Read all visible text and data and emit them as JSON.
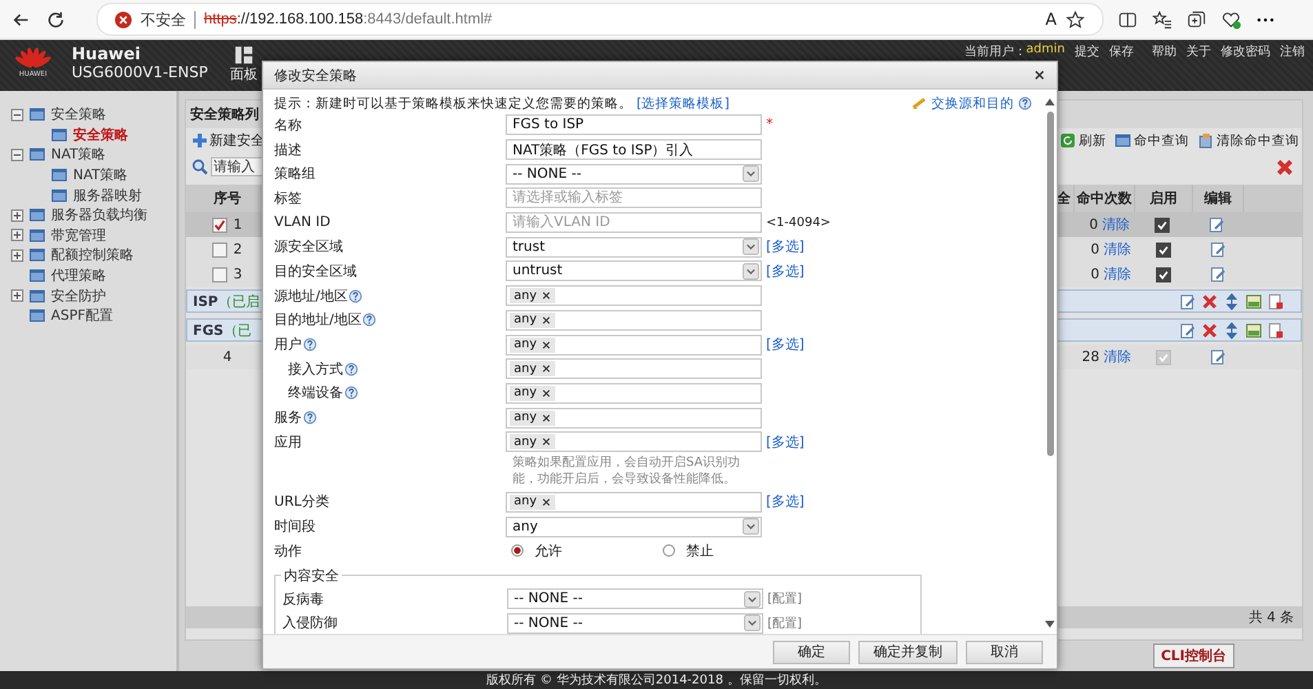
{
  "browser": {
    "security_label": "不安全",
    "url_scheme": "https",
    "url_host": "://192.168.100.158",
    "url_rest": ":8443/default.html#",
    "read_aloud": "A"
  },
  "header": {
    "logo_text": "HUAWEI",
    "brand": "Huawei",
    "model": "USG6000V1-ENSP",
    "nav_tab": "面板",
    "user_label": "当前用户：",
    "user": "admin",
    "links": [
      "提交",
      "保存",
      "帮助",
      "关于",
      "修改密码",
      "注销"
    ]
  },
  "sidebar": {
    "items": [
      {
        "label": "安全策略",
        "kind": "folder",
        "expanded": true,
        "selected": false,
        "children": [
          {
            "label": "安全策略",
            "selected": true
          }
        ]
      },
      {
        "label": "NAT策略",
        "kind": "folder",
        "expanded": true,
        "selected": false,
        "children": [
          {
            "label": "NAT策略",
            "selected": false
          },
          {
            "label": "服务器映射",
            "selected": false
          }
        ]
      },
      {
        "label": "服务器负载均衡",
        "kind": "folder",
        "expanded": false,
        "selected": false
      },
      {
        "label": "带宽管理",
        "kind": "folder",
        "expanded": false,
        "selected": false
      },
      {
        "label": "配额控制策略",
        "kind": "folder",
        "expanded": false,
        "selected": false
      },
      {
        "label": "代理策略",
        "kind": "leaf",
        "selected": false
      },
      {
        "label": "安全防护",
        "kind": "folder",
        "expanded": false,
        "selected": false
      },
      {
        "label": "ASPF配置",
        "kind": "leaf",
        "selected": false
      }
    ]
  },
  "main": {
    "title": "安全策略列",
    "new_button": "新建安全",
    "search": {
      "placeholder": "请输入"
    },
    "tools": [
      "刷新",
      "命中查询",
      "清除命中查询"
    ],
    "columns_left": [
      "序号"
    ],
    "columns_right": [
      "全",
      "命中次数",
      "启用",
      "编辑"
    ],
    "rows": [
      {
        "kind": "rule",
        "number": "1",
        "checked": true,
        "selected": true,
        "hits": "0",
        "clear": "清除",
        "enabled": true,
        "disabled": false
      },
      {
        "kind": "rule",
        "number": "2",
        "checked": false,
        "selected": false,
        "hits": "0",
        "clear": "清除",
        "enabled": true,
        "disabled": false
      },
      {
        "kind": "rule",
        "number": "3",
        "checked": false,
        "selected": false,
        "hits": "0",
        "clear": "清除",
        "enabled": true,
        "disabled": false
      },
      {
        "kind": "group",
        "name": "ISP",
        "status": "（已启"
      },
      {
        "kind": "group",
        "name": "FGS",
        "status": "（已"
      },
      {
        "kind": "plain",
        "number": "4",
        "hits": "28",
        "clear": "清除",
        "enabled": true,
        "disabled": true
      }
    ],
    "total": "共 4 条",
    "cli_button": "CLI控制台"
  },
  "dialog": {
    "title": "修改安全策略",
    "hint": "提示：新建时可以基于策略模板来快速定义您需要的策略。",
    "hint_link": "[选择策略模板]",
    "swap_link": "交换源和目的",
    "rows": [
      {
        "label": "名称",
        "kind": "input",
        "value": "FGS to ISP",
        "required_mark": "*"
      },
      {
        "label": "描述",
        "kind": "input",
        "value": "NAT策略（FGS to ISP）引入"
      },
      {
        "label": "策略组",
        "kind": "select",
        "value": "-- NONE --"
      },
      {
        "label": "标签",
        "kind": "input",
        "placeholder": "请选择或输入标签"
      },
      {
        "label": "VLAN ID",
        "kind": "input",
        "placeholder": "请输入VLAN ID",
        "suffix": "<1-4094>"
      },
      {
        "label": "源安全区域",
        "kind": "select",
        "value": "trust",
        "link": "[多选]"
      },
      {
        "label": "目的安全区域",
        "kind": "select",
        "value": "untrust",
        "link": "[多选]"
      },
      {
        "label": "源地址/地区",
        "kind": "tags",
        "help": true,
        "tags": [
          "any"
        ]
      },
      {
        "label": "目的地址/地区",
        "kind": "tags",
        "help": true,
        "tags": [
          "any"
        ]
      },
      {
        "label": "用户",
        "kind": "tags",
        "help": true,
        "tags": [
          "any"
        ],
        "link": "[多选]",
        "children": [
          {
            "label": "接入方式",
            "kind": "tags",
            "help": true,
            "tags": [
              "any"
            ]
          },
          {
            "label": "终端设备",
            "kind": "tags",
            "help": true,
            "tags": [
              "any"
            ]
          }
        ]
      },
      {
        "label": "服务",
        "kind": "tags",
        "help": true,
        "tags": [
          "any"
        ]
      },
      {
        "label": "应用",
        "kind": "tags",
        "tags": [
          "any"
        ],
        "link": "[多选]",
        "note": "策略如果配置应用，会自动开启SA识别功能，功能开启后，会导致设备性能降低。"
      },
      {
        "label": "URL分类",
        "kind": "tags",
        "tags": [
          "any"
        ],
        "link": "[多选]"
      },
      {
        "label": "时间段",
        "kind": "select",
        "value": "any"
      },
      {
        "label": "动作",
        "kind": "radio",
        "options": [
          {
            "label": "允许",
            "selected": true
          },
          {
            "label": "禁止",
            "selected": false
          }
        ]
      }
    ],
    "content_security": {
      "legend": "内容安全",
      "rows": [
        {
          "label": "反病毒",
          "value": "-- NONE --",
          "link": "[配置]"
        },
        {
          "label": "入侵防御",
          "value": "-- NONE --",
          "link": "[配置]"
        }
      ]
    },
    "buttons": [
      "确定",
      "确定并复制",
      "取消"
    ]
  },
  "footer": "版权所有 © 华为技术有限公司2014-2018 。保留一切权利。"
}
